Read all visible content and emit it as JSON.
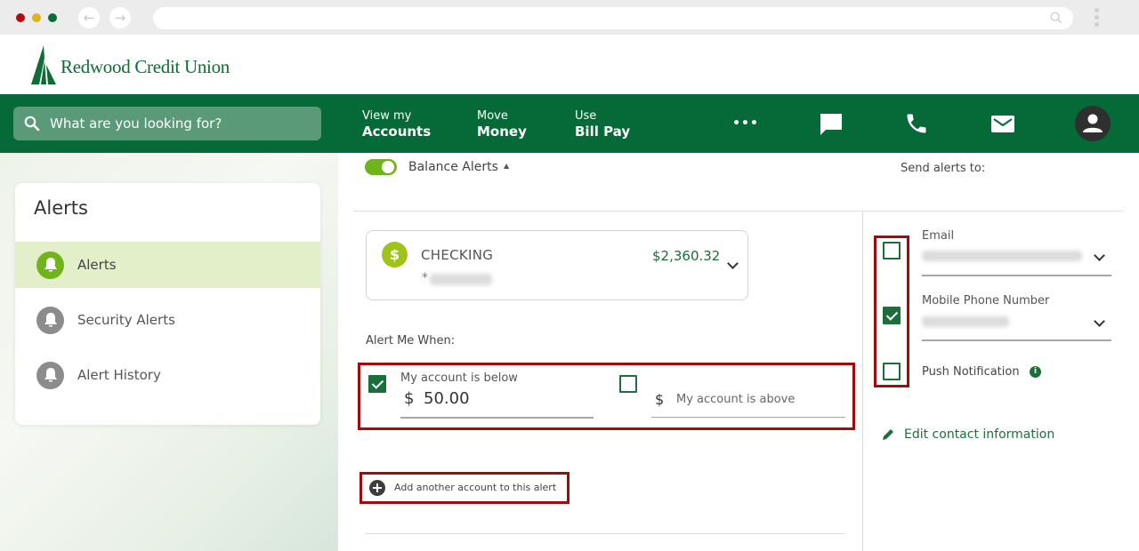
{
  "browser": {
    "back_icon": "←",
    "forward_icon": "→",
    "url": ""
  },
  "brand": {
    "name": "Redwood Credit Union",
    "primary_color": "#066a38",
    "accent_color": "#6fb41a",
    "highlight_color": "#a10b0b"
  },
  "nav": {
    "search_placeholder": "What are you looking for?",
    "links": [
      {
        "small": "View my",
        "big": "Accounts"
      },
      {
        "small": "Move",
        "big": "Money"
      },
      {
        "small": "Use",
        "big": "Bill Pay"
      }
    ],
    "more_label": "•••",
    "icons": [
      "chat-icon",
      "phone-icon",
      "mail-icon",
      "account-icon"
    ]
  },
  "sidebar": {
    "title": "Alerts",
    "items": [
      {
        "label": "Alerts",
        "active": true
      },
      {
        "label": "Security Alerts",
        "active": false
      },
      {
        "label": "Alert History",
        "active": false
      }
    ]
  },
  "balance_alert": {
    "section_label": "Balance Alerts",
    "enabled": true,
    "collapse_icon": "▲",
    "account": {
      "type": "CHECKING",
      "number_prefix": "*",
      "balance": "$2,360.32",
      "icon": "$"
    },
    "alert_me_when_label": "Alert Me When:",
    "below": {
      "checked": true,
      "label": "My account is below",
      "currency": "$",
      "value": "50.00"
    },
    "above": {
      "checked": false,
      "currency": "$",
      "placeholder": "My account is above",
      "value": ""
    },
    "add_account_label": "Add another account to this alert"
  },
  "send_to": {
    "title": "Send alerts to:",
    "email": {
      "label": "Email",
      "checked": false
    },
    "mobile": {
      "label": "Mobile Phone Number",
      "checked": true
    },
    "push": {
      "label": "Push Notification",
      "checked": false,
      "info_icon": "i"
    },
    "edit_contact_label": "Edit contact information"
  }
}
